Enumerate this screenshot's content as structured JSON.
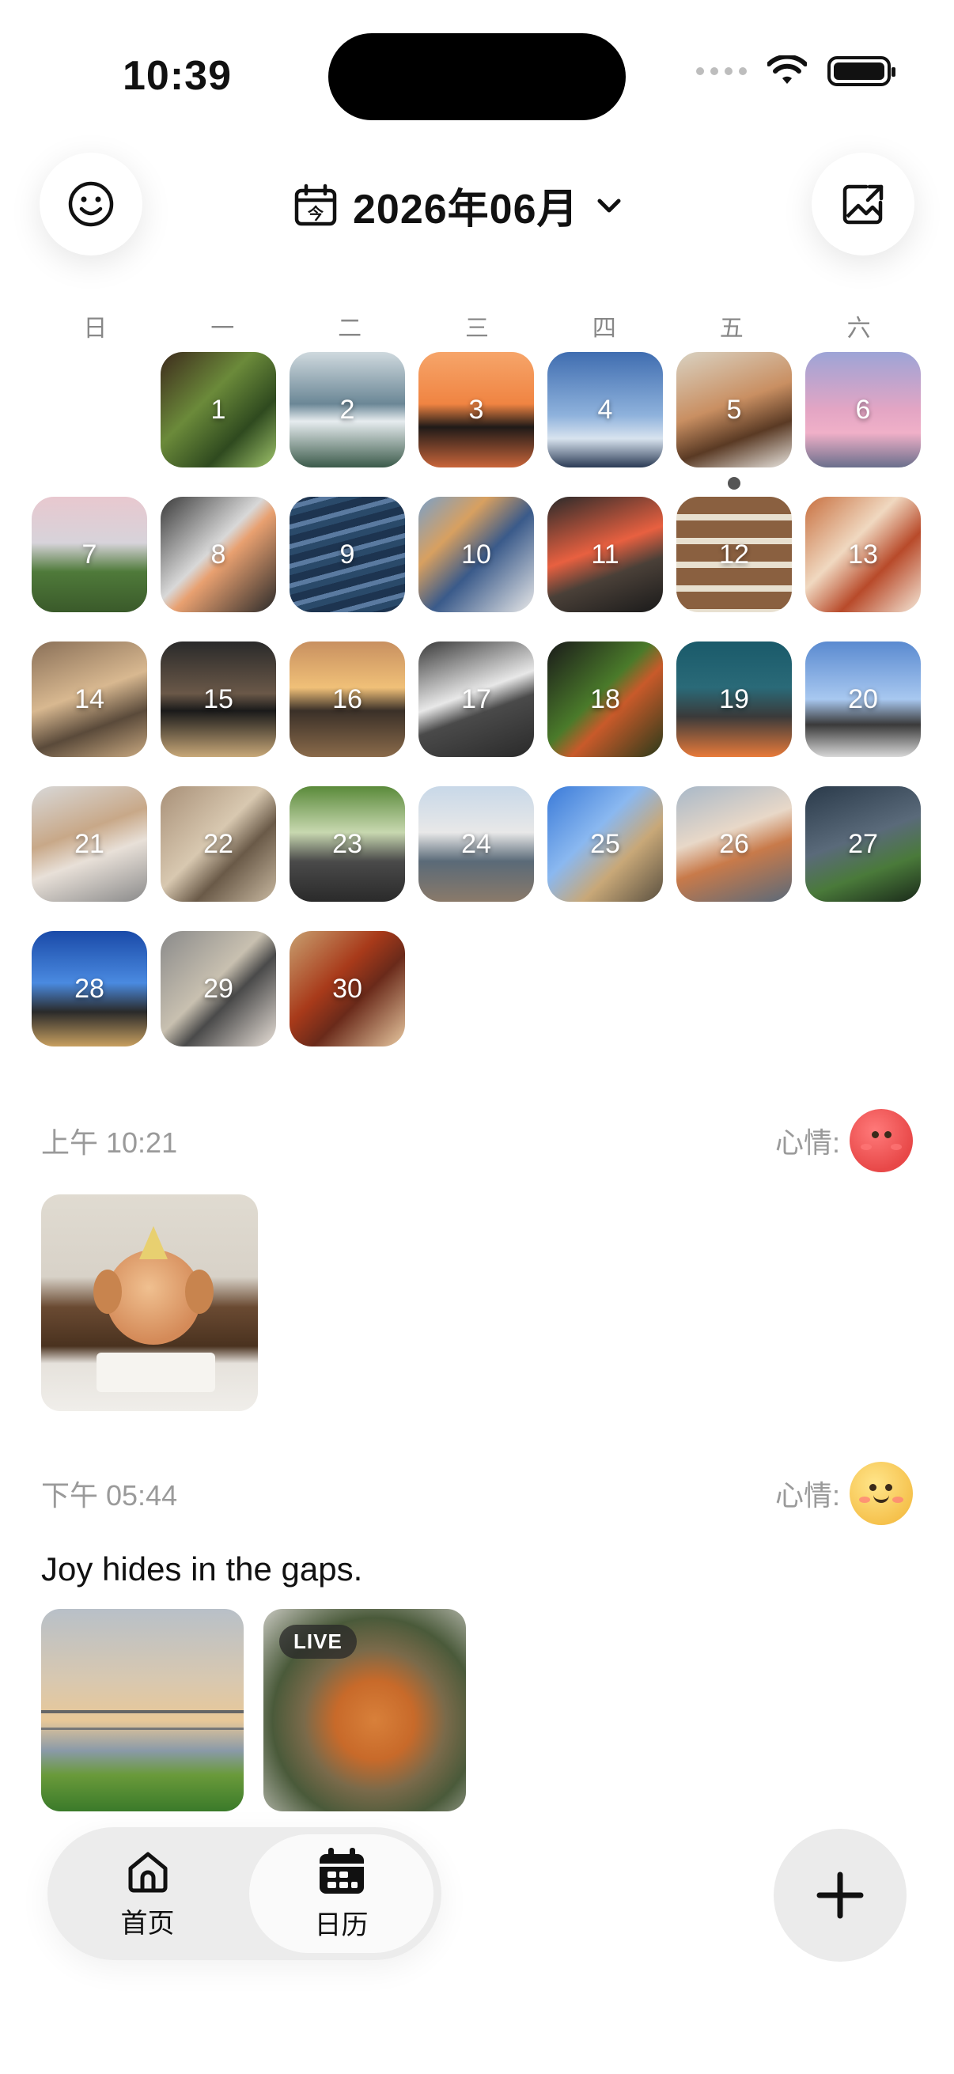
{
  "status_bar": {
    "time": "10:39"
  },
  "header": {
    "month_title": "2026年06月",
    "mood_button_icon": "smiley-icon",
    "share_button_icon": "share-image-icon",
    "calendar_icon": "calendar-today-icon",
    "calendar_icon_char": "今",
    "dropdown_icon": "chevron-down-icon"
  },
  "weekdays": [
    "日",
    "一",
    "二",
    "三",
    "四",
    "五",
    "六"
  ],
  "calendar": {
    "leading_empty": 1,
    "selected_day": "5",
    "days": [
      {
        "n": "1",
        "bg": "linear-gradient(135deg,#3d2a1c,#6b8a3a 40%,#2f4a1f 70%,#9fc46b)"
      },
      {
        "n": "2",
        "bg": "linear-gradient(180deg,#cfd9de,#6b8796 45%,#e6ecef 60%,#3b5a4a)"
      },
      {
        "n": "3",
        "bg": "linear-gradient(180deg,#f6a56a,#f08442 45%,#1f1a18 65%,#c9653a)"
      },
      {
        "n": "4",
        "bg": "linear-gradient(180deg,#3f6db0,#8fb2dc 55%,#d8e3ef 75%,#2b3b55)"
      },
      {
        "n": "5",
        "bg": "linear-gradient(160deg,#d9d2c2,#c98f62 45%,#5a3a24 70%,#e8e4de)"
      },
      {
        "n": "6",
        "bg": "linear-gradient(180deg,#9da4d6,#e3a5c4 50%,#f0b0c8 70%,#6a6f8c)"
      },
      {
        "n": "7",
        "bg": "linear-gradient(180deg,#e8c8cf,#d7d3da 40%,#4f7a3a 65%,#3a5a2a)"
      },
      {
        "n": "8",
        "bg": "linear-gradient(135deg,#3a3a3a,#d8d8d8 45%,#e8a070 55%,#2a2a2a)"
      },
      {
        "n": "9",
        "bg": "repeating-linear-gradient(165deg,#1d3450 0 10px,#5a7aa0 10px 16px,#2a4a6a 16px 24px)"
      },
      {
        "n": "10",
        "bg": "linear-gradient(135deg,#7aa0c8,#d8a060 30%,#3a5a8a 55%,#e8e8e8)"
      },
      {
        "n": "11",
        "bg": "linear-gradient(160deg,#2a2a2a,#e86040 45%,#4a4038 65%,#1a1a1a)"
      },
      {
        "n": "12",
        "bg": "repeating-linear-gradient(180deg,#8a6040 0 22px,#e8e0d0 22px 30px)"
      },
      {
        "n": "13",
        "bg": "linear-gradient(135deg,#c87040,#f0d8c0 40%,#b84a2a 65%,#f5e8d8)"
      },
      {
        "n": "14",
        "bg": "linear-gradient(160deg,#8a7058,#d8b890 45%,#5a4a3a 70%,#c8a880)"
      },
      {
        "n": "15",
        "bg": "linear-gradient(180deg,#2a2a2a,#6a5848 45%,#1a1a1a 60%,#c8a878)"
      },
      {
        "n": "16",
        "bg": "linear-gradient(180deg,#c89060,#f0c078 40%,#3a3028 60%,#8a6a4a)"
      },
      {
        "n": "17",
        "bg": "linear-gradient(160deg,#3a3a3a,#e8e8e8 45%,#4a4a4a 60%,#2a2a2a)"
      },
      {
        "n": "18",
        "bg": "linear-gradient(135deg,#1a1a1a,#4a7a2a 45%,#c85a2a 60%,#2a3a1a)"
      },
      {
        "n": "19",
        "bg": "linear-gradient(180deg,#1a5a6a,#2a6a78 40%,#3a3a3a 65%,#e87a3a)"
      },
      {
        "n": "20",
        "bg": "linear-gradient(180deg,#5a8ad0,#a8c8f0 50%,#3a3a3a 72%,#d8d8d8)"
      },
      {
        "n": "21",
        "bg": "linear-gradient(160deg,#d8d8d8,#c8a888 40%,#e8e0d8 60%,#8a8a8a)"
      },
      {
        "n": "22",
        "bg": "linear-gradient(135deg,#a89078,#d8c8b0 45%,#6a5a48 65%,#c8b8a0)"
      },
      {
        "n": "23",
        "bg": "linear-gradient(180deg,#5a8a3a,#c8d8b0 40%,#4a4a4a 65%,#2a2a2a)"
      },
      {
        "n": "24",
        "bg": "linear-gradient(180deg,#c8d8e8,#e8e8e8 40%,#5a6a78 65%,#8a7a6a)"
      },
      {
        "n": "25",
        "bg": "linear-gradient(135deg,#3a7ad8,#8ab8f0 40%,#c8a878 65%,#5a5040)"
      },
      {
        "n": "26",
        "bg": "linear-gradient(160deg,#a8b8c8,#e8d8c8 40%,#c87a4a 60%,#5a6a7a)"
      },
      {
        "n": "27",
        "bg": "linear-gradient(160deg,#2a3a4a,#5a6a7a 45%,#4a7a3a 70%,#1a2a1a)"
      },
      {
        "n": "28",
        "bg": "linear-gradient(180deg,#1a4aa8,#4a8ae0 45%,#2a2a2a 70%,#c8a060)"
      },
      {
        "n": "29",
        "bg": "linear-gradient(135deg,#8a8a8a,#c8c0b0 45%,#4a4a4a 60%,#e8e0d8)"
      },
      {
        "n": "30",
        "bg": "linear-gradient(135deg,#c8a070,#a83a1a 40%,#6a2a1a 60%,#e8c8a0)"
      }
    ]
  },
  "entries": [
    {
      "time": "上午 10:21",
      "mood_label": "心情:",
      "mood_icon": "red-mood-face-icon"
    },
    {
      "time": "下午 05:44",
      "mood_label": "心情:",
      "mood_icon": "happy-mood-face-icon",
      "text": "Joy hides in the gaps.",
      "live_label": "LIVE"
    }
  ],
  "tabbar": {
    "home_label": "首页",
    "calendar_label": "日历"
  },
  "colors": {
    "accent": "#111111",
    "muted_text": "#9a9a9a",
    "tabbar_bg": "#ececec",
    "today_dot": "#555555"
  }
}
